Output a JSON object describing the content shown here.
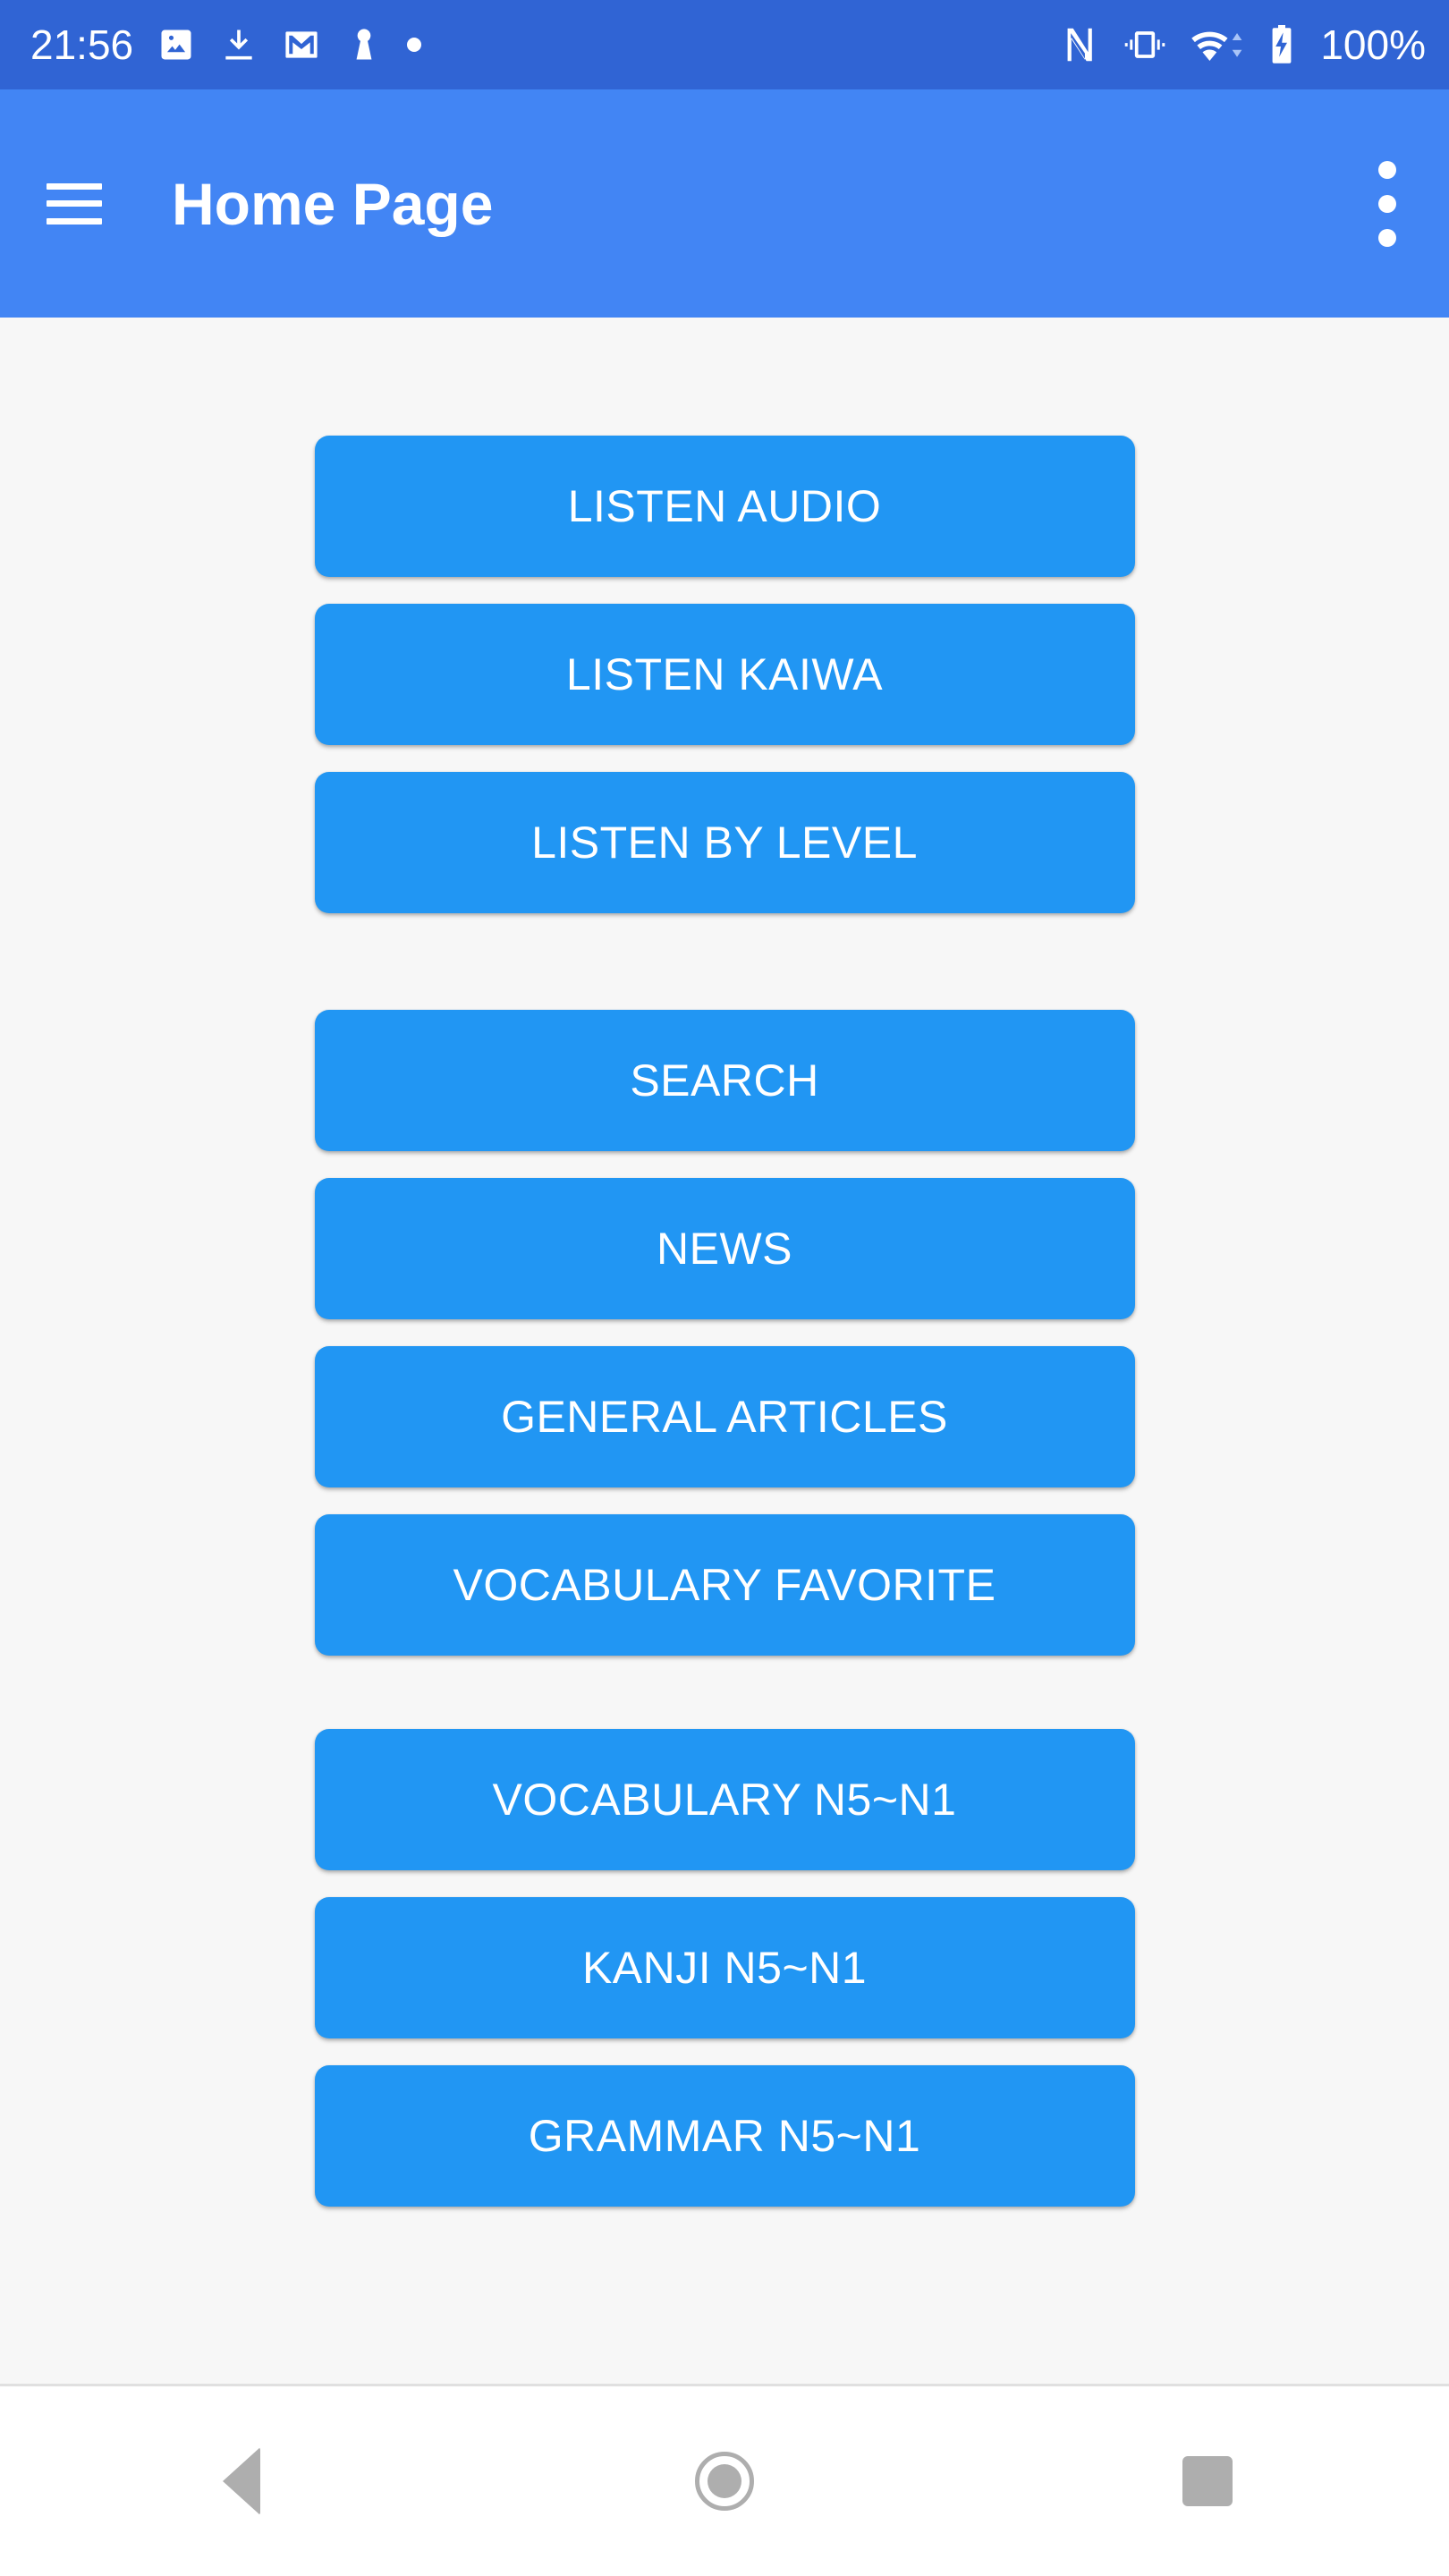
{
  "status_bar": {
    "time": "21:56",
    "battery_text": "100%",
    "background_color": "#3064d4",
    "left_icons": [
      {
        "name": "photo-icon"
      },
      {
        "name": "download-icon"
      },
      {
        "name": "gmail-icon"
      },
      {
        "name": "keyhole-icon"
      },
      {
        "name": "dot-indicator-icon"
      }
    ],
    "right_icons": [
      {
        "name": "nfc-icon"
      },
      {
        "name": "vibrate-icon"
      },
      {
        "name": "wifi-icon"
      },
      {
        "name": "battery-charging-icon"
      }
    ]
  },
  "app_bar": {
    "title": "Home Page",
    "background_color": "#4285f4",
    "menu_icon": "hamburger-menu-icon",
    "overflow_icon": "overflow-menu-icon"
  },
  "main": {
    "background_color": "#f7f7f7",
    "button_color": "#2196f3",
    "button_groups": [
      {
        "group_name": "listen",
        "buttons": [
          {
            "label": "LISTEN AUDIO",
            "name": "listen-audio-button"
          },
          {
            "label": "LISTEN KAIWA",
            "name": "listen-kaiwa-button"
          },
          {
            "label": "LISTEN BY LEVEL",
            "name": "listen-by-level-button"
          }
        ]
      },
      {
        "group_name": "content",
        "buttons": [
          {
            "label": "SEARCH",
            "name": "search-button"
          },
          {
            "label": "NEWS",
            "name": "news-button"
          },
          {
            "label": "GENERAL ARTICLES",
            "name": "general-articles-button"
          },
          {
            "label": "VOCABULARY FAVORITE",
            "name": "vocabulary-favorite-button"
          }
        ]
      },
      {
        "group_name": "study",
        "buttons": [
          {
            "label": "VOCABULARY N5~N1",
            "name": "vocabulary-levels-button"
          },
          {
            "label": "KANJI N5~N1",
            "name": "kanji-levels-button"
          },
          {
            "label": "GRAMMAR N5~N1",
            "name": "grammar-levels-button"
          }
        ]
      }
    ]
  },
  "nav_bar": {
    "background_color": "#ffffff",
    "buttons": [
      {
        "name": "nav-back-button",
        "icon": "back-triangle-icon"
      },
      {
        "name": "nav-home-button",
        "icon": "home-circle-icon"
      },
      {
        "name": "nav-recents-button",
        "icon": "recents-square-icon"
      }
    ]
  }
}
